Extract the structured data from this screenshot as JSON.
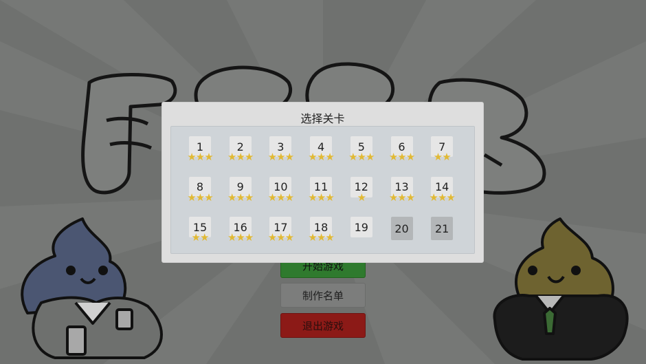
{
  "game": {
    "logo_text": "屌丝大逃",
    "menu": {
      "start_label": "开始游戏",
      "credits_label": "制作名单",
      "quit_label": "退出游戏"
    }
  },
  "level_select": {
    "title": "选择关卡",
    "levels": [
      {
        "number": "1",
        "stars": 3,
        "locked": false
      },
      {
        "number": "2",
        "stars": 3,
        "locked": false
      },
      {
        "number": "3",
        "stars": 3,
        "locked": false
      },
      {
        "number": "4",
        "stars": 3,
        "locked": false
      },
      {
        "number": "5",
        "stars": 3,
        "locked": false
      },
      {
        "number": "6",
        "stars": 3,
        "locked": false
      },
      {
        "number": "7",
        "stars": 2,
        "locked": false
      },
      {
        "number": "8",
        "stars": 3,
        "locked": false
      },
      {
        "number": "9",
        "stars": 3,
        "locked": false
      },
      {
        "number": "10",
        "stars": 3,
        "locked": false
      },
      {
        "number": "11",
        "stars": 3,
        "locked": false
      },
      {
        "number": "12",
        "stars": 1,
        "locked": false
      },
      {
        "number": "13",
        "stars": 3,
        "locked": false
      },
      {
        "number": "14",
        "stars": 3,
        "locked": false
      },
      {
        "number": "15",
        "stars": 2,
        "locked": false
      },
      {
        "number": "16",
        "stars": 3,
        "locked": false
      },
      {
        "number": "17",
        "stars": 3,
        "locked": false
      },
      {
        "number": "18",
        "stars": 3,
        "locked": false
      },
      {
        "number": "19",
        "stars": 0,
        "locked": false
      },
      {
        "number": "20",
        "stars": 0,
        "locked": true
      },
      {
        "number": "21",
        "stars": 0,
        "locked": true
      }
    ]
  },
  "colors": {
    "star": "#e1b934",
    "overlay_bg": "#6f716f",
    "start_button": "#2f7a2e",
    "quit_button": "#8c1a17",
    "blue_character": "#4b5672",
    "brown_character": "#6e6330"
  }
}
